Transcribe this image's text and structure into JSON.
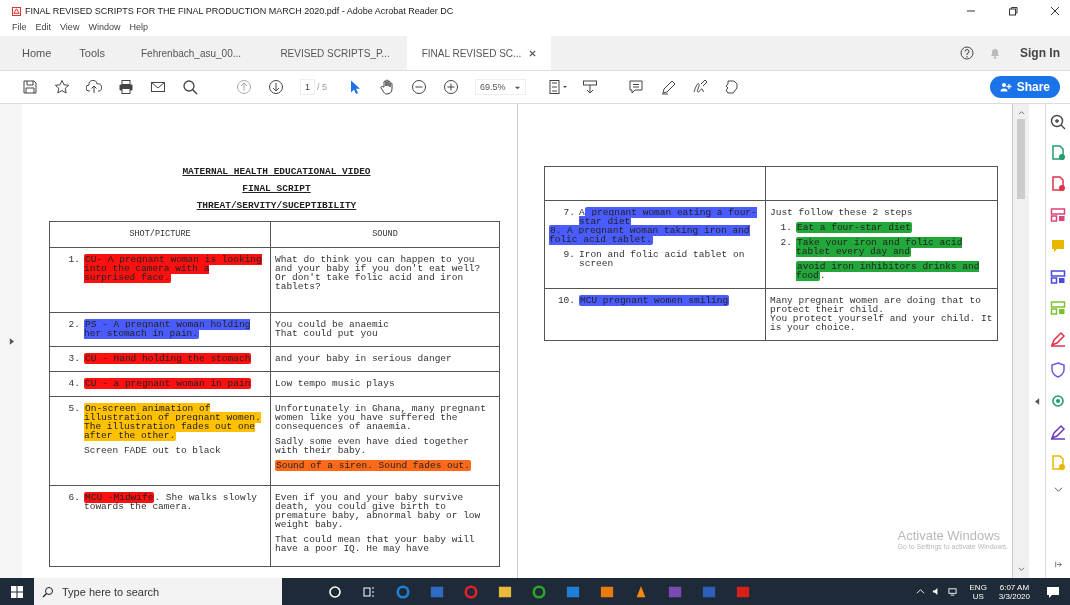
{
  "window": {
    "title": "FINAL REVISED SCRIPTS FOR THE FINAL PRODUCTION MARCH 2020.pdf - Adobe Acrobat Reader DC"
  },
  "menu": [
    "File",
    "Edit",
    "View",
    "Window",
    "Help"
  ],
  "tabs": [
    {
      "label": "Home",
      "selected": false,
      "kind": "nav"
    },
    {
      "label": "Tools",
      "selected": false,
      "kind": "nav"
    },
    {
      "label": "Fehrenbach_asu_00...",
      "selected": false,
      "kind": "doc"
    },
    {
      "label": "REVISED SCRIPTS_P...",
      "selected": false,
      "kind": "doc"
    },
    {
      "label": "FINAL REVISED SC...",
      "selected": true,
      "kind": "doc"
    }
  ],
  "sign_in": "Sign In",
  "toolbar": {
    "page": "1",
    "page_count": "/ 5",
    "zoom": "69.5%",
    "share": "Share"
  },
  "left_page": {
    "headings": [
      "MATERNAL HEALTH EDUCATIONAL VIDEO",
      "FINAL SCRIPT",
      "THREAT/SERVITY/SUCEPTIBILITY"
    ],
    "columns": [
      "SHOT/PICTURE",
      "SOUND"
    ],
    "rows": [
      {
        "shot": [
          {
            "kind": "item",
            "number": "1.",
            "parts": [
              {
                "text": "CU- A pregnant woman is looking into the camera with a surprised face.",
                "color": "#ff1010"
              }
            ]
          }
        ],
        "sound": [
          {
            "kind": "text",
            "parts": [
              {
                "text": "What do think you can happen to you and your baby if you don't eat well? Or don't take folic acid and iron tablets?"
              }
            ]
          }
        ]
      },
      {
        "shot": [
          {
            "kind": "item",
            "number": "2.",
            "parts": [
              {
                "text": "PS - A pregnant woman holding her stomach in pain.",
                "color": "#4a5cff"
              }
            ]
          }
        ],
        "sound": [
          {
            "kind": "text",
            "parts": [
              {
                "text": "You could be anaemic"
              }
            ]
          },
          {
            "kind": "line",
            "parts": [
              {
                "text": "That could put you"
              }
            ]
          }
        ]
      },
      {
        "shot": [
          {
            "kind": "item",
            "number": "3.",
            "parts": [
              {
                "text": "CU - Hand holding the stomach",
                "color": "#ff1010"
              }
            ]
          }
        ],
        "sound": [
          {
            "kind": "text",
            "parts": [
              {
                "text": "and your baby in serious danger"
              }
            ]
          }
        ]
      },
      {
        "shot": [
          {
            "kind": "item",
            "number": "4.",
            "parts": [
              {
                "text": "CU - a pregnant woman in pain",
                "color": "#ff1010"
              }
            ]
          }
        ],
        "sound": [
          {
            "kind": "text",
            "parts": [
              {
                "text": "Low tempo music plays"
              }
            ]
          }
        ]
      },
      {
        "shot": [
          {
            "kind": "item",
            "number": "5.",
            "parts": [
              {
                "text": "On-screen animation of illustration of pregnant women. The illustration fades out one after the other.",
                "color": "#ffc000"
              }
            ]
          },
          {
            "kind": "cont",
            "parts": [
              {
                "text": "Screen FADE out to black"
              }
            ]
          }
        ],
        "sound": [
          {
            "kind": "text",
            "parts": [
              {
                "text": "Unfortunately in Ghana, many pregnant women like you have suffered the consequences of anaemia."
              }
            ]
          },
          {
            "kind": "text",
            "parts": [
              {
                "text": "Sadly some even have died together with their baby."
              }
            ]
          },
          {
            "kind": "text",
            "parts": [
              {
                "text": "Sound of a siren. Sound fades out.",
                "color": "#ff6a1a"
              }
            ]
          }
        ]
      },
      {
        "shot": [
          {
            "kind": "item",
            "number": "6.",
            "parts": [
              {
                "text": "MCU -Midwife",
                "color": "#ff1010"
              },
              {
                "text": ". She walks slowly towards the camera."
              }
            ]
          }
        ],
        "sound": [
          {
            "kind": "text",
            "parts": [
              {
                "text": "Even if you and your baby survive death, you could give birth to premature baby, abnormal baby or low weight baby."
              }
            ]
          },
          {
            "kind": "text",
            "parts": [
              {
                "text": "That could mean that your baby will have a poor IQ. He may have"
              }
            ]
          }
        ]
      }
    ]
  },
  "right_page": {
    "rows": [
      {
        "shot": [],
        "sound": []
      },
      {
        "shot": [
          {
            "kind": "item",
            "number": "7.",
            "parts": [
              {
                "text": "A"
              },
              {
                "text": " pregnant woman eating a four-star diet",
                "color": "#4a5cff"
              }
            ]
          },
          {
            "kind": "line",
            "parts": [
              {
                "text": "8. A pregnant woman taking iron and folic acid tablet.",
                "color": "#4a5cff"
              }
            ]
          },
          {
            "kind": "item",
            "number": "9.",
            "parts": [
              {
                "text": "Iron and folic acid tablet on screen"
              }
            ]
          }
        ],
        "sound": [
          {
            "kind": "line",
            "parts": [
              {
                "text": "Just follow these 2 steps"
              }
            ]
          },
          {
            "kind": "sub",
            "number": "1.",
            "parts": [
              {
                "text": "Eat a four-star diet",
                "color": "#22a83a"
              }
            ]
          },
          {
            "kind": "sub",
            "number": "2.",
            "parts": [
              {
                "text": "Take your iron and folic acid tablet every day and",
                "color": "#22a83a"
              }
            ]
          },
          {
            "kind": "subcont",
            "parts": [
              {
                "text": "avoid iron inhibitors drinks and food",
                "color": "#22a83a"
              },
              {
                "text": "."
              }
            ]
          }
        ]
      },
      {
        "shot": [
          {
            "kind": "item",
            "number": "10.",
            "parts": [
              {
                "text": "MCU pregnant women smiling",
                "color": "#4a5cff"
              }
            ]
          }
        ],
        "sound": [
          {
            "kind": "line",
            "parts": [
              {
                "text": "Many pregnant women are doing that to protect their child."
              }
            ]
          },
          {
            "kind": "line",
            "parts": [
              {
                "text": "You protect yourself and your child. It is your choice."
              }
            ]
          }
        ]
      }
    ]
  },
  "activation": {
    "title": "Activate Windows",
    "subtitle": "Go to Settings to activate Windows."
  },
  "taskbar": {
    "search_placeholder": "Type here to search",
    "language": "ENG",
    "region": "US",
    "time": "6:07 AM",
    "date": "3/3/2020"
  }
}
